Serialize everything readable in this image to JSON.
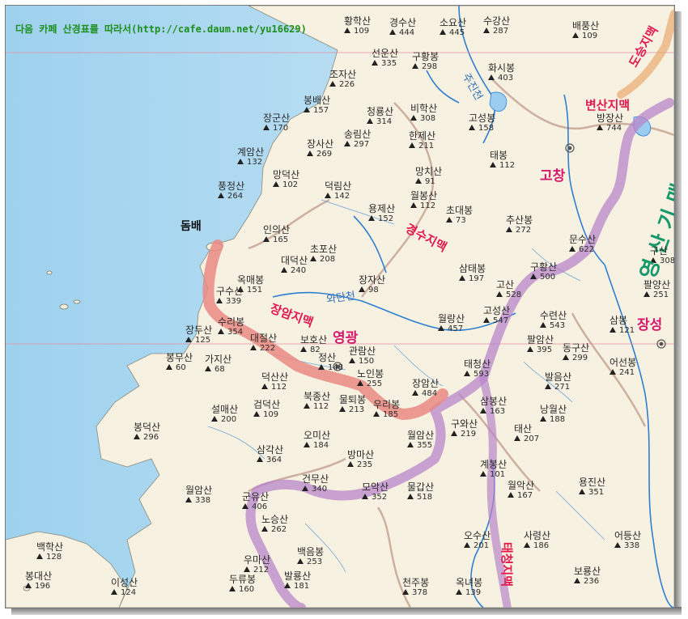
{
  "credit": "다음 카페 산경표를 따라서(http://cafe.daum.net/yu16629)",
  "island_label": "돔배",
  "county_labels": [
    {
      "key": "yeonggwang",
      "text": "영광"
    },
    {
      "key": "gochang",
      "text": "고창"
    },
    {
      "key": "jangseong",
      "text": "장성"
    }
  ],
  "ridge_labels": [
    {
      "key": "jangam",
      "text": "장암지맥"
    },
    {
      "key": "gyeongsu",
      "text": "경수지맥"
    },
    {
      "key": "byeonsan",
      "text": "변산지맥"
    },
    {
      "key": "taecheong",
      "text": "태청지맥"
    },
    {
      "key": "doseung",
      "text": "도승지맥"
    }
  ],
  "range_label": "영 산 기 맥",
  "river_labels": [
    {
      "key": "wattan",
      "text": "와탄천"
    },
    {
      "key": "jusin",
      "text": "주진천"
    }
  ],
  "peaks": [
    {
      "key": "hwanghak",
      "name": "황학산",
      "elev": "109"
    },
    {
      "key": "gyeongsu",
      "name": "경수산",
      "elev": "444"
    },
    {
      "key": "soyo",
      "name": "소요산",
      "elev": "445"
    },
    {
      "key": "sugang",
      "name": "수강산",
      "elev": "287"
    },
    {
      "key": "baepung",
      "name": "배풍산",
      "elev": "109"
    },
    {
      "key": "seonun",
      "name": "선운산",
      "elev": "335"
    },
    {
      "key": "guhwang1",
      "name": "구황봉",
      "elev": "298"
    },
    {
      "key": "hwasi",
      "name": "화시봉",
      "elev": "403"
    },
    {
      "key": "joja",
      "name": "조자산",
      "elev": "226"
    },
    {
      "key": "bongbae",
      "name": "봉배산",
      "elev": "157"
    },
    {
      "key": "cheongnyong",
      "name": "청룡산",
      "elev": "314"
    },
    {
      "key": "bihak",
      "name": "비학산",
      "elev": "308"
    },
    {
      "key": "gosung",
      "name": "고성봉",
      "elev": "158"
    },
    {
      "key": "banghang",
      "name": "방장산",
      "elev": "744"
    },
    {
      "key": "janggun",
      "name": "장군산",
      "elev": "170"
    },
    {
      "key": "songrim",
      "name": "송림산",
      "elev": "297"
    },
    {
      "key": "hanje",
      "name": "한제산",
      "elev": "211"
    },
    {
      "key": "jangsa",
      "name": "장사산",
      "elev": "269"
    },
    {
      "key": "taebong",
      "name": "태봉",
      "elev": "112"
    },
    {
      "key": "gyeam",
      "name": "계암산",
      "elev": "132"
    },
    {
      "key": "mangchi",
      "name": "망치산",
      "elev": "91"
    },
    {
      "key": "mangdeok",
      "name": "망덕산",
      "elev": "102"
    },
    {
      "key": "deokrim",
      "name": "덕림산",
      "elev": "142"
    },
    {
      "key": "pungjeong",
      "name": "풍정산",
      "elev": "264"
    },
    {
      "key": "wolbong",
      "name": "월봉산",
      "elev": "112"
    },
    {
      "key": "yongje",
      "name": "용제산",
      "elev": "152"
    },
    {
      "key": "chudae",
      "name": "초대봉",
      "elev": "73"
    },
    {
      "key": "chusan",
      "name": "추산봉",
      "elev": "272"
    },
    {
      "key": "munsu",
      "name": "문수산",
      "elev": "622"
    },
    {
      "key": "inui",
      "name": "인의산",
      "elev": "165"
    },
    {
      "key": "chopo",
      "name": "초포산",
      "elev": "208"
    },
    {
      "key": "daedeok",
      "name": "대덕산",
      "elev": "240"
    },
    {
      "key": "jangja",
      "name": "장자산",
      "elev": "98"
    },
    {
      "key": "samtae",
      "name": "삼태봉",
      "elev": "197"
    },
    {
      "key": "guhwang2",
      "name": "구황산",
      "elev": "500"
    },
    {
      "key": "okmae",
      "name": "옥매봉",
      "elev": "151"
    },
    {
      "key": "gosan",
      "name": "고산",
      "elev": "528"
    },
    {
      "key": "gusu",
      "name": "구수산",
      "elev": "339"
    },
    {
      "key": "wollang",
      "name": "월랑산",
      "elev": "457"
    },
    {
      "key": "gosung2",
      "name": "고성산",
      "elev": "547"
    },
    {
      "key": "suryeon",
      "name": "수련산",
      "elev": "543"
    },
    {
      "key": "sambong",
      "name": "삼봉",
      "elev": "121"
    },
    {
      "key": "jangdu",
      "name": "장두산",
      "elev": "125"
    },
    {
      "key": "surim",
      "name": "수리봉",
      "elev": "354"
    },
    {
      "key": "daejeol",
      "name": "대절산",
      "elev": "222"
    },
    {
      "key": "boho",
      "name": "보호산",
      "elev": "82"
    },
    {
      "key": "gwallam",
      "name": "관람산",
      "elev": "150"
    },
    {
      "key": "param",
      "name": "팔암산",
      "elev": "395"
    },
    {
      "key": "donggu",
      "name": "동구산",
      "elev": "299"
    },
    {
      "key": "bongmu",
      "name": "봉무산",
      "elev": "60"
    },
    {
      "key": "gaji",
      "name": "가지산",
      "elev": "68"
    },
    {
      "key": "jeongsan",
      "name": "정산",
      "elev": "148"
    },
    {
      "key": "noin",
      "name": "노인봉",
      "elev": "255"
    },
    {
      "key": "taecheong",
      "name": "태청산",
      "elev": "593"
    },
    {
      "key": "baleum",
      "name": "발음산",
      "elev": "271"
    },
    {
      "key": "eunseon",
      "name": "어선봉",
      "elev": "241"
    },
    {
      "key": "deoksan",
      "name": "덕산산",
      "elev": "112"
    },
    {
      "key": "bukjong",
      "name": "북종산",
      "elev": "112"
    },
    {
      "key": "multol",
      "name": "물퇴봉",
      "elev": "213"
    },
    {
      "key": "jangam",
      "name": "장암산",
      "elev": "484"
    },
    {
      "key": "samjong",
      "name": "삼봉산",
      "elev": "163"
    },
    {
      "key": "nangwol",
      "name": "낭월산",
      "elev": "188"
    },
    {
      "key": "seolmae",
      "name": "설매산",
      "elev": "200"
    },
    {
      "key": "geomdeok",
      "name": "검덕산",
      "elev": "109"
    },
    {
      "key": "uri",
      "name": "우리봉",
      "elev": "185"
    },
    {
      "key": "guwa",
      "name": "구와산",
      "elev": "219"
    },
    {
      "key": "taesan",
      "name": "태산",
      "elev": "207"
    },
    {
      "key": "bongdeok",
      "name": "봉덕산",
      "elev": "296"
    },
    {
      "key": "omi",
      "name": "오미산",
      "elev": "184"
    },
    {
      "key": "wolam2",
      "name": "월암산",
      "elev": "355"
    },
    {
      "key": "samgak",
      "name": "삼각산",
      "elev": "364"
    },
    {
      "key": "bangma",
      "name": "방마산",
      "elev": "235"
    },
    {
      "key": "gyebong",
      "name": "계봉산",
      "elev": "101"
    },
    {
      "key": "wolak",
      "name": "월악산",
      "elev": "167"
    },
    {
      "key": "yongjin",
      "name": "용진산",
      "elev": "351"
    },
    {
      "key": "geonmu",
      "name": "건무산",
      "elev": "340"
    },
    {
      "key": "moak",
      "name": "모악산",
      "elev": "352"
    },
    {
      "key": "mulgap",
      "name": "물갑산",
      "elev": "518"
    },
    {
      "key": "wolam",
      "name": "월암산",
      "elev": "338"
    },
    {
      "key": "gunyu",
      "name": "군유산",
      "elev": "406"
    },
    {
      "key": "nosung",
      "name": "노승산",
      "elev": "262"
    },
    {
      "key": "osu",
      "name": "오수산",
      "elev": "201"
    },
    {
      "key": "saryeong",
      "name": "사령산",
      "elev": "186"
    },
    {
      "key": "eodeung",
      "name": "어등산",
      "elev": "338"
    },
    {
      "key": "baekhak",
      "name": "백학산",
      "elev": "128"
    },
    {
      "key": "baegeum",
      "name": "백음봉",
      "elev": "253"
    },
    {
      "key": "umasan",
      "name": "우마산",
      "elev": "212"
    },
    {
      "key": "daedae",
      "name": "봉대산",
      "elev": "196"
    },
    {
      "key": "iseong",
      "name": "이성산",
      "elev": "124"
    },
    {
      "key": "duryu",
      "name": "두류봉",
      "elev": "160"
    },
    {
      "key": "balyong",
      "name": "발룡산",
      "elev": "181"
    },
    {
      "key": "cheonju",
      "name": "천주봉",
      "elev": "378"
    },
    {
      "key": "okrye",
      "name": "옥녀봉",
      "elev": "139"
    },
    {
      "key": "boryong",
      "name": "보룡산",
      "elev": "236"
    },
    {
      "key": "paryang",
      "name": "팔양산",
      "elev": "251"
    },
    {
      "key": "gusan3",
      "name": "구산",
      "elev": "308"
    }
  ]
}
